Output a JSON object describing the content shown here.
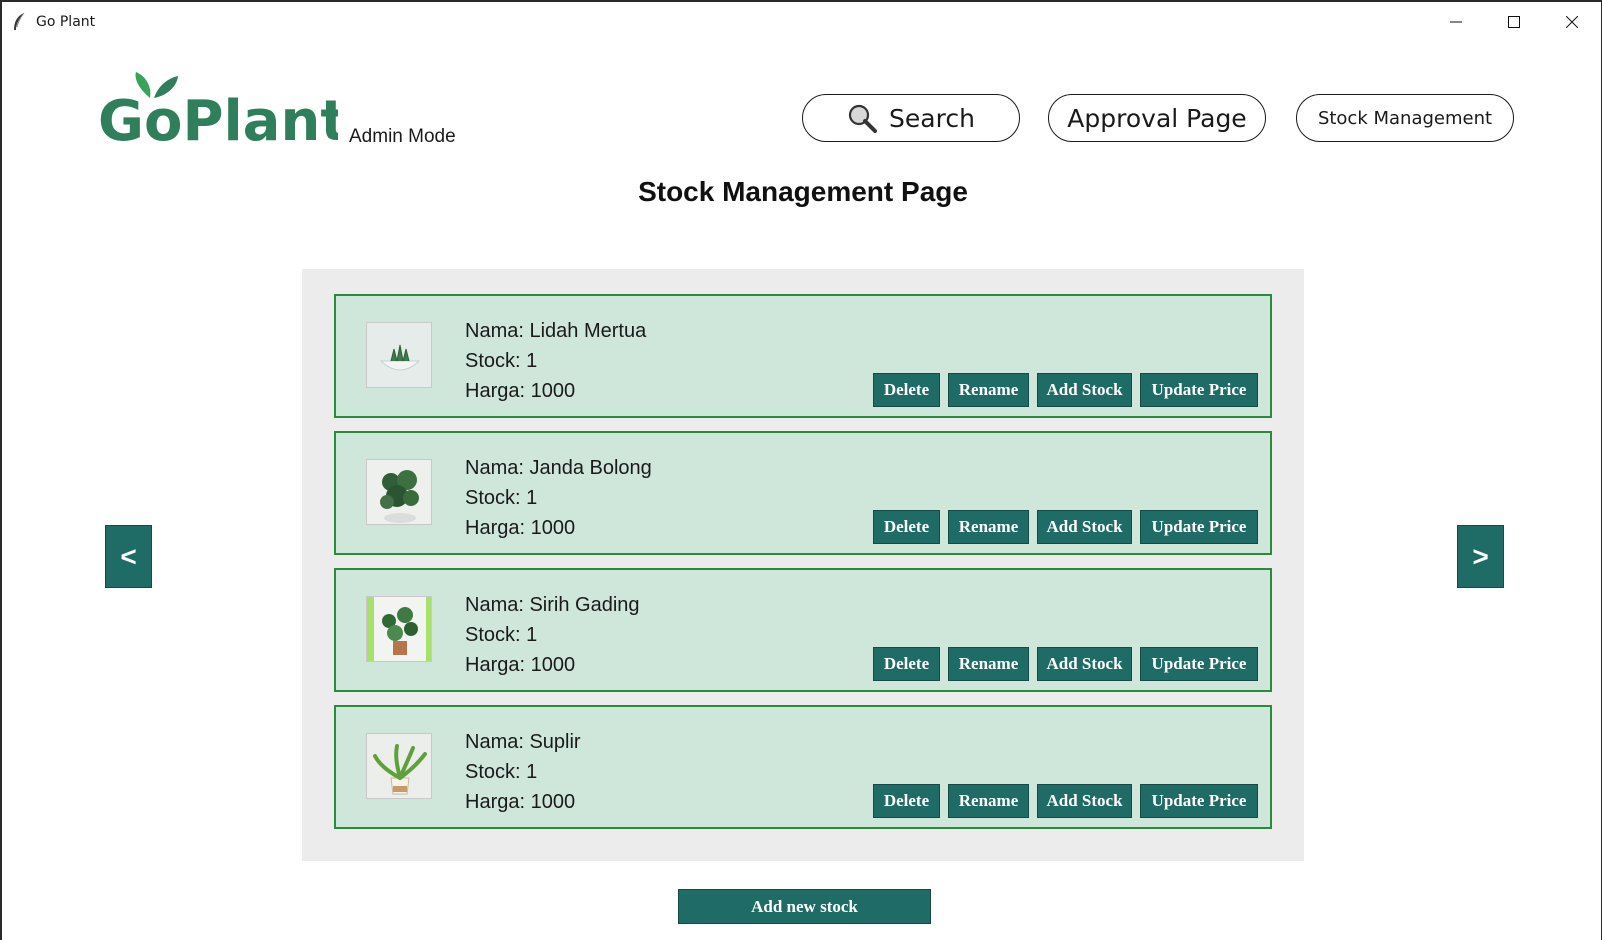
{
  "window": {
    "title": "Go Plant"
  },
  "header": {
    "logo_text": "GoPlant",
    "mode_label": "Admin Mode",
    "nav": {
      "search": "Search",
      "approval": "Approval Page",
      "stock": "Stock Management"
    }
  },
  "page_title": "Stock Management Page",
  "items": [
    {
      "name": "Nama: Lidah Mertua",
      "stock": "Stock: 1",
      "price": "Harga: 1000",
      "image": "snake-plant-image"
    },
    {
      "name": "Nama: Janda Bolong",
      "stock": "Stock: 1",
      "price": "Harga: 1000",
      "image": "monstera-plant-image"
    },
    {
      "name": "Nama: Sirih Gading",
      "stock": "Stock: 1",
      "price": "Harga: 1000",
      "image": "pothos-plant-image"
    },
    {
      "name": "Nama: Suplir",
      "stock": "Stock: 1",
      "price": "Harga: 1000",
      "image": "fern-plant-image"
    }
  ],
  "actions": {
    "delete": "Delete",
    "rename": "Rename",
    "add_stock": "Add Stock",
    "update_price": "Update Price"
  },
  "pager": {
    "prev": "<",
    "next": ">"
  },
  "add_new": "Add new stock",
  "colors": {
    "accent": "#1f6b66",
    "card_bg": "#cfe6db",
    "card_border": "#2a8c3a",
    "panel_bg": "#ececec",
    "logo_green": "#2f7f5c"
  }
}
